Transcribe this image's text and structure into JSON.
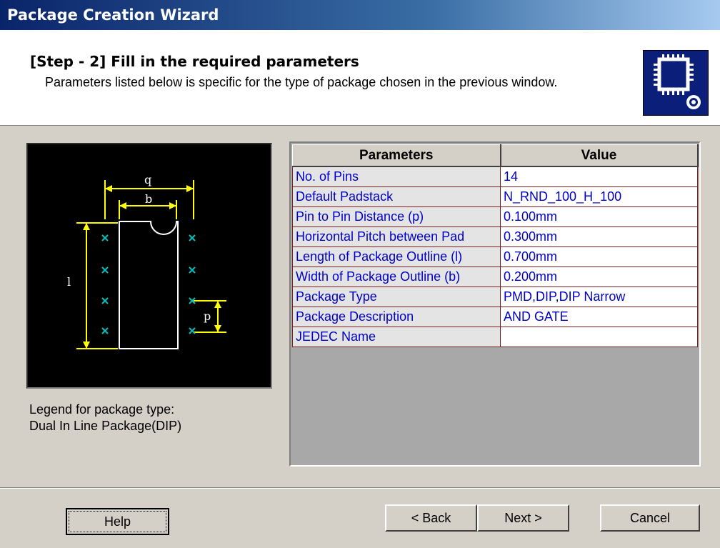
{
  "window": {
    "title": "Package Creation Wizard"
  },
  "header": {
    "title": "[Step - 2] Fill in the required parameters",
    "description": "Parameters listed below is specific for the type of package chosen in the previous window.",
    "icon": "chip-icon"
  },
  "diagram": {
    "labels": {
      "q": "q",
      "b": "b",
      "l": "l",
      "p": "p"
    },
    "colors": {
      "dimension": "#ffff00",
      "body": "#ffffff",
      "pin": "#00c0c0"
    }
  },
  "legend": {
    "line1": "Legend for package type:",
    "line2": "Dual In Line Package(DIP)"
  },
  "table": {
    "headers": {
      "param": "Parameters",
      "value": "Value"
    },
    "rows": [
      {
        "param": "No. of Pins",
        "value": "14"
      },
      {
        "param": "Default Padstack",
        "value": "N_RND_100_H_100"
      },
      {
        "param": "Pin to Pin Distance (p)",
        "value": "0.100mm"
      },
      {
        "param": "Horizontal Pitch between Pad",
        "value": "0.300mm"
      },
      {
        "param": "Length of Package Outline (l)",
        "value": "0.700mm"
      },
      {
        "param": "Width of Package Outline (b)",
        "value": "0.200mm"
      },
      {
        "param": "Package Type",
        "value": "PMD,DIP,DIP Narrow"
      },
      {
        "param": "Package Description",
        "value": "AND GATE"
      },
      {
        "param": "JEDEC Name",
        "value": ""
      }
    ]
  },
  "buttons": {
    "help": "Help",
    "back": "< Back",
    "next": "Next >",
    "cancel": "Cancel"
  }
}
